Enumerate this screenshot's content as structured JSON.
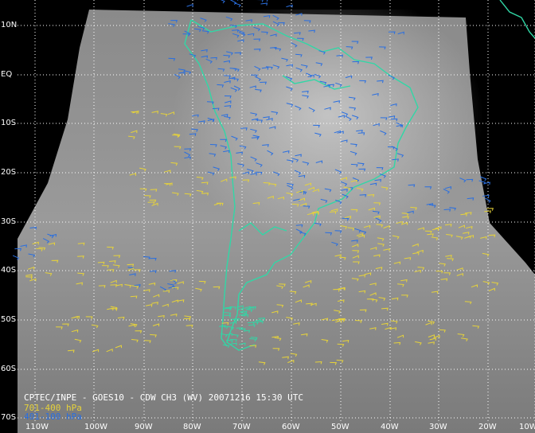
{
  "product": {
    "caption": "CPTEC/INPE - GOES10 - CDW CH3 (WV) 20071216 15:30 UTC"
  },
  "legend": [
    {
      "label": "701-400 hPa",
      "color": "#e6d23a"
    },
    {
      "label": "401-100 hPa",
      "color": "#2a6fe0"
    }
  ],
  "latitude_labels": [
    "10N",
    "EQ",
    "10S",
    "20S",
    "30S",
    "40S",
    "50S",
    "60S",
    "70S"
  ],
  "longitude_labels": [
    "110W",
    "100W",
    "90W",
    "80W",
    "70W",
    "60W",
    "50W",
    "40W",
    "30W",
    "20W",
    "10W"
  ],
  "colors": {
    "coastline": "#31d7a6",
    "grid": "#ffffff",
    "background": "#000000",
    "low_level_vectors": "#e6d23a",
    "high_level_vectors": "#2a6fe0",
    "text": "#ffffff"
  }
}
